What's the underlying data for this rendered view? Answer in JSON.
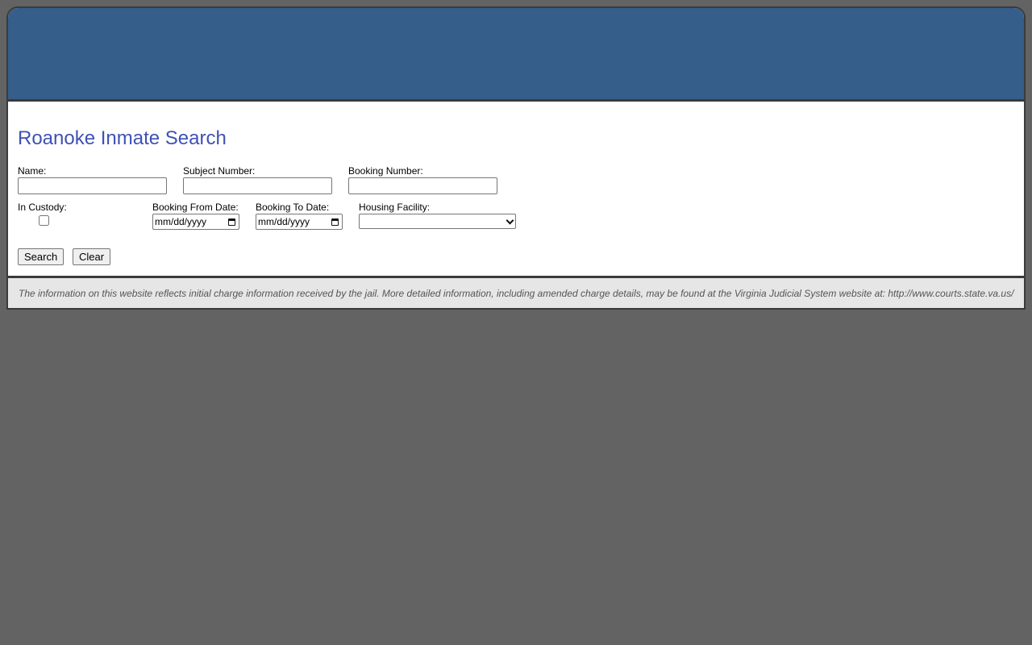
{
  "page": {
    "title": "Roanoke Inmate Search"
  },
  "form": {
    "name_label": "Name:",
    "name_value": "",
    "subject_number_label": "Subject Number:",
    "subject_number_value": "",
    "booking_number_label": "Booking Number:",
    "booking_number_value": "",
    "in_custody_label": "In Custody:",
    "in_custody_checked": false,
    "booking_from_label": "Booking From Date:",
    "booking_from_placeholder": "mm/dd/yyyy",
    "booking_to_label": "Booking To Date:",
    "booking_to_placeholder": "mm/dd/yyyy",
    "housing_facility_label": "Housing Facility:",
    "housing_facility_selected": "",
    "search_label": "Search",
    "clear_label": "Clear"
  },
  "footer": {
    "note": "The information on this website reflects initial charge information received by the jail. More detailed information, including amended charge details, may be found at the Virginia Judicial System website at: http://www.courts.state.va.us/"
  },
  "colors": {
    "page_background": "#636363",
    "banner": "#355f8a",
    "title": "#3f51b5",
    "footer_background": "#e6e6e6"
  },
  "icons": {
    "date_picker": "calendar-icon",
    "select_toggle": "chevron-down-icon"
  }
}
